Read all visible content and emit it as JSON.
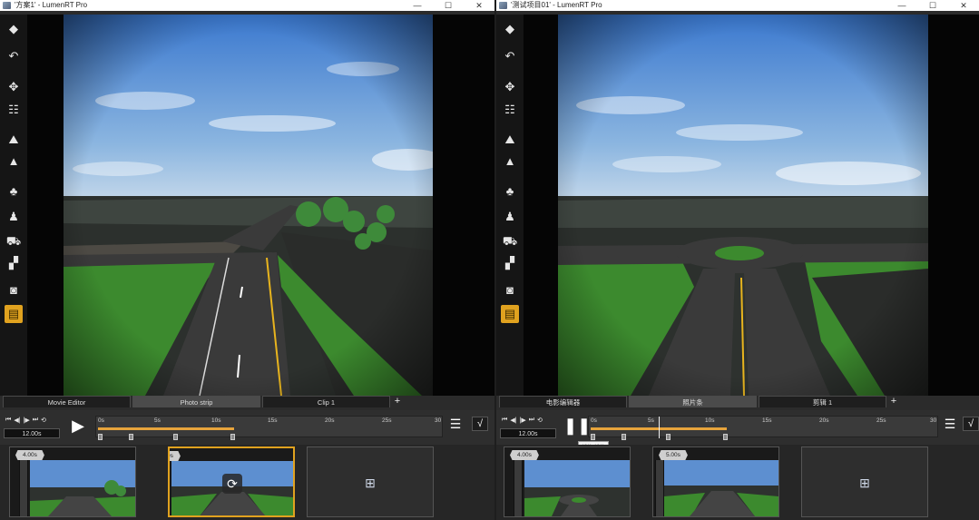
{
  "windows": [
    {
      "title": "'方案1' - LumenRT Pro",
      "controls": {
        "minimize": "—",
        "maximize": "☐",
        "close": "✕"
      },
      "tabs": [
        {
          "label": "Movie Editor",
          "selected": false
        },
        {
          "label": "Photo strip",
          "selected": true
        },
        {
          "label": "Clip 1",
          "selected": false
        }
      ],
      "tab_add": "+",
      "timeline": {
        "time_value": "12.00s",
        "ticks": [
          "0s",
          "5s",
          "10s",
          "15s",
          "20s",
          "25s",
          "30"
        ],
        "play_icon": "play-icon",
        "tooltip": ""
      },
      "clips": [
        {
          "duration": "4.00s",
          "scene": "road-palms",
          "selected": false
        },
        {
          "duration": "5.00s",
          "scene": "road-straight",
          "selected": true
        }
      ]
    },
    {
      "title": "'测试项目01' - LumenRT Pro",
      "controls": {
        "minimize": "—",
        "maximize": "☐",
        "close": "✕"
      },
      "tabs": [
        {
          "label": "电影编辑器",
          "selected": false
        },
        {
          "label": "照片条",
          "selected": true
        },
        {
          "label": "剪辑 1",
          "selected": false
        }
      ],
      "tab_add": "+",
      "timeline": {
        "time_value": "12.00s",
        "ticks": [
          "0s",
          "5s",
          "10s",
          "15s",
          "20s",
          "25s",
          "30"
        ],
        "play_icon": "pause-icon",
        "tooltip": "播放/暂停"
      },
      "clips": [
        {
          "duration": "4.00s",
          "scene": "roundabout",
          "selected": false
        },
        {
          "duration": "5.00s",
          "scene": "road-straight",
          "selected": false
        }
      ]
    }
  ],
  "toolbar_icons": [
    "cube-icon",
    "undo-icon",
    "move-icon",
    "sliders-icon",
    "terrain-icon",
    "mountain-icon",
    "tree-icon",
    "person-icon",
    "car-icon",
    "objects-icon",
    "camera-icon",
    "clapperboard-icon"
  ],
  "colors": {
    "accent": "#e0a21f",
    "timeline_bar": "#e7a43c",
    "sky_top": "#3f7fcf",
    "grass": "#3c8a2e"
  }
}
